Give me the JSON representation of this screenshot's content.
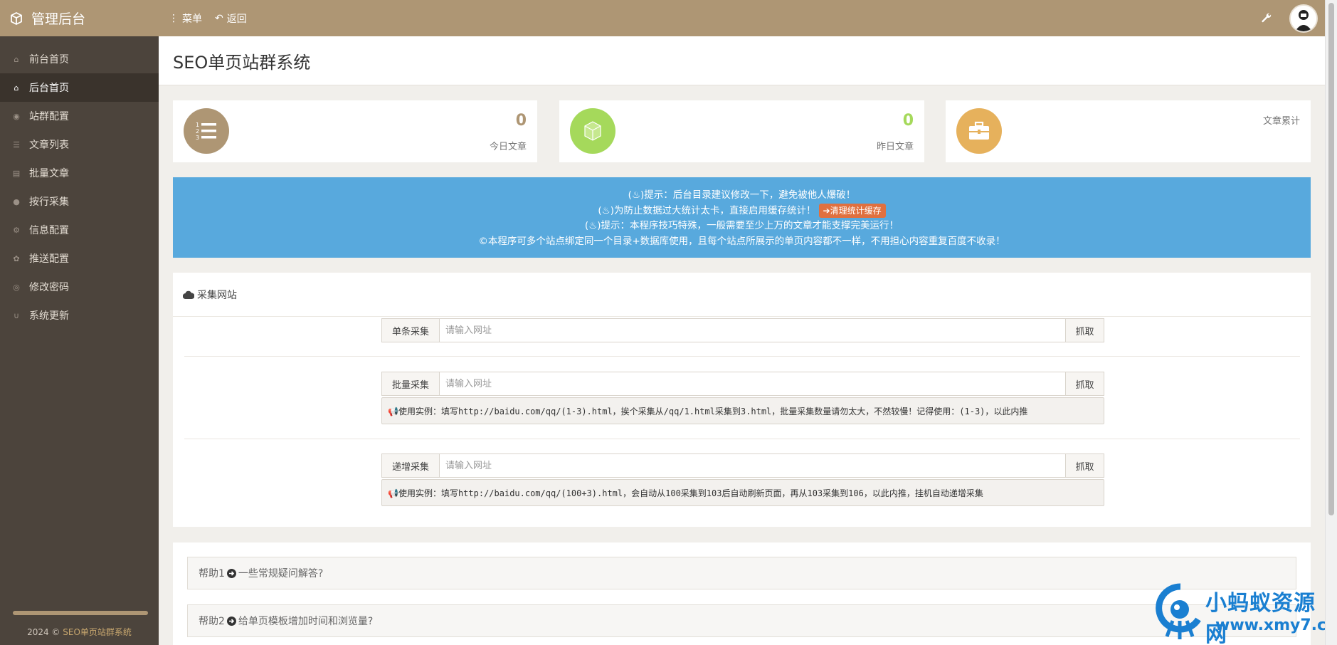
{
  "app": {
    "title": "管理后台"
  },
  "topbar": {
    "menu_label": "菜单",
    "back_label": "返回"
  },
  "sidebar": {
    "items": [
      {
        "label": "前台首页",
        "icon": "home-icon"
      },
      {
        "label": "后台首页",
        "icon": "home-icon",
        "active": true
      },
      {
        "label": "站群配置",
        "icon": "chrome-icon"
      },
      {
        "label": "文章列表",
        "icon": "list-icon"
      },
      {
        "label": "批量文章",
        "icon": "book-icon"
      },
      {
        "label": "按行采集",
        "icon": "circle-icon"
      },
      {
        "label": "信息配置",
        "icon": "gear-icon"
      },
      {
        "label": "推送配置",
        "icon": "paw-icon"
      },
      {
        "label": "修改密码",
        "icon": "user-circle-icon"
      },
      {
        "label": "系统更新",
        "icon": "magnet-icon"
      }
    ],
    "footer_year": "2024 ©",
    "footer_brand": "SEO单页站群系统"
  },
  "page": {
    "title": "SEO单页站群系统"
  },
  "stats": [
    {
      "value": "0",
      "label": "今日文章",
      "color": "#ae9674",
      "icon": "ordered-list-icon"
    },
    {
      "value": "0",
      "label": "昨日文章",
      "color": "#a5d95b",
      "icon": "cube-icon"
    },
    {
      "value": "",
      "label": "文章累计",
      "color": "#e6b15c",
      "icon": "briefcase-icon"
    }
  ],
  "notice": {
    "line1": "(♨)提示：后台目录建议修改一下，避免被他人爆破！",
    "line2": "(♨)为防止数据过大统计太卡，直接启用缓存统计！",
    "clear_button": "➔清理统计缓存",
    "line3": "(♨)提示：本程序技巧特殊，一般需要至少上万的文章才能支撑完美运行！",
    "line4": "©本程序可多个站点绑定同一个目录+数据库使用，且每个站点所展示的单页内容都不一样，不用担心内容重复百度不收录！"
  },
  "collect": {
    "title": "采集网站",
    "rows": [
      {
        "addon": "单条采集",
        "placeholder": "请输入网址",
        "button": "抓取",
        "example": ""
      },
      {
        "addon": "批量采集",
        "placeholder": "请输入网址",
        "button": "抓取",
        "example": "📢使用实例：填写http://baidu.com/qq/(1-3).html，挨个采集从/qq/1.html采集到3.html，批量采集数量请勿太大，不然较慢！记得使用：(1-3)，以此内推"
      },
      {
        "addon": "递增采集",
        "placeholder": "请输入网址",
        "button": "抓取",
        "example": "📢使用实例：填写http://baidu.com/qq/(100+3).html，会自动从100采集到103后自动刷新页面，再从103采集到106，以此内推，挂机自动递增采集"
      }
    ]
  },
  "help": [
    {
      "prefix": "帮助1",
      "text": "一些常规疑问解答?"
    },
    {
      "prefix": "帮助2",
      "text": "给单页模板增加时间和浏览量?"
    }
  ],
  "watermark": {
    "name": "小蚂蚁资源网",
    "url": "www.xmy7.com"
  }
}
